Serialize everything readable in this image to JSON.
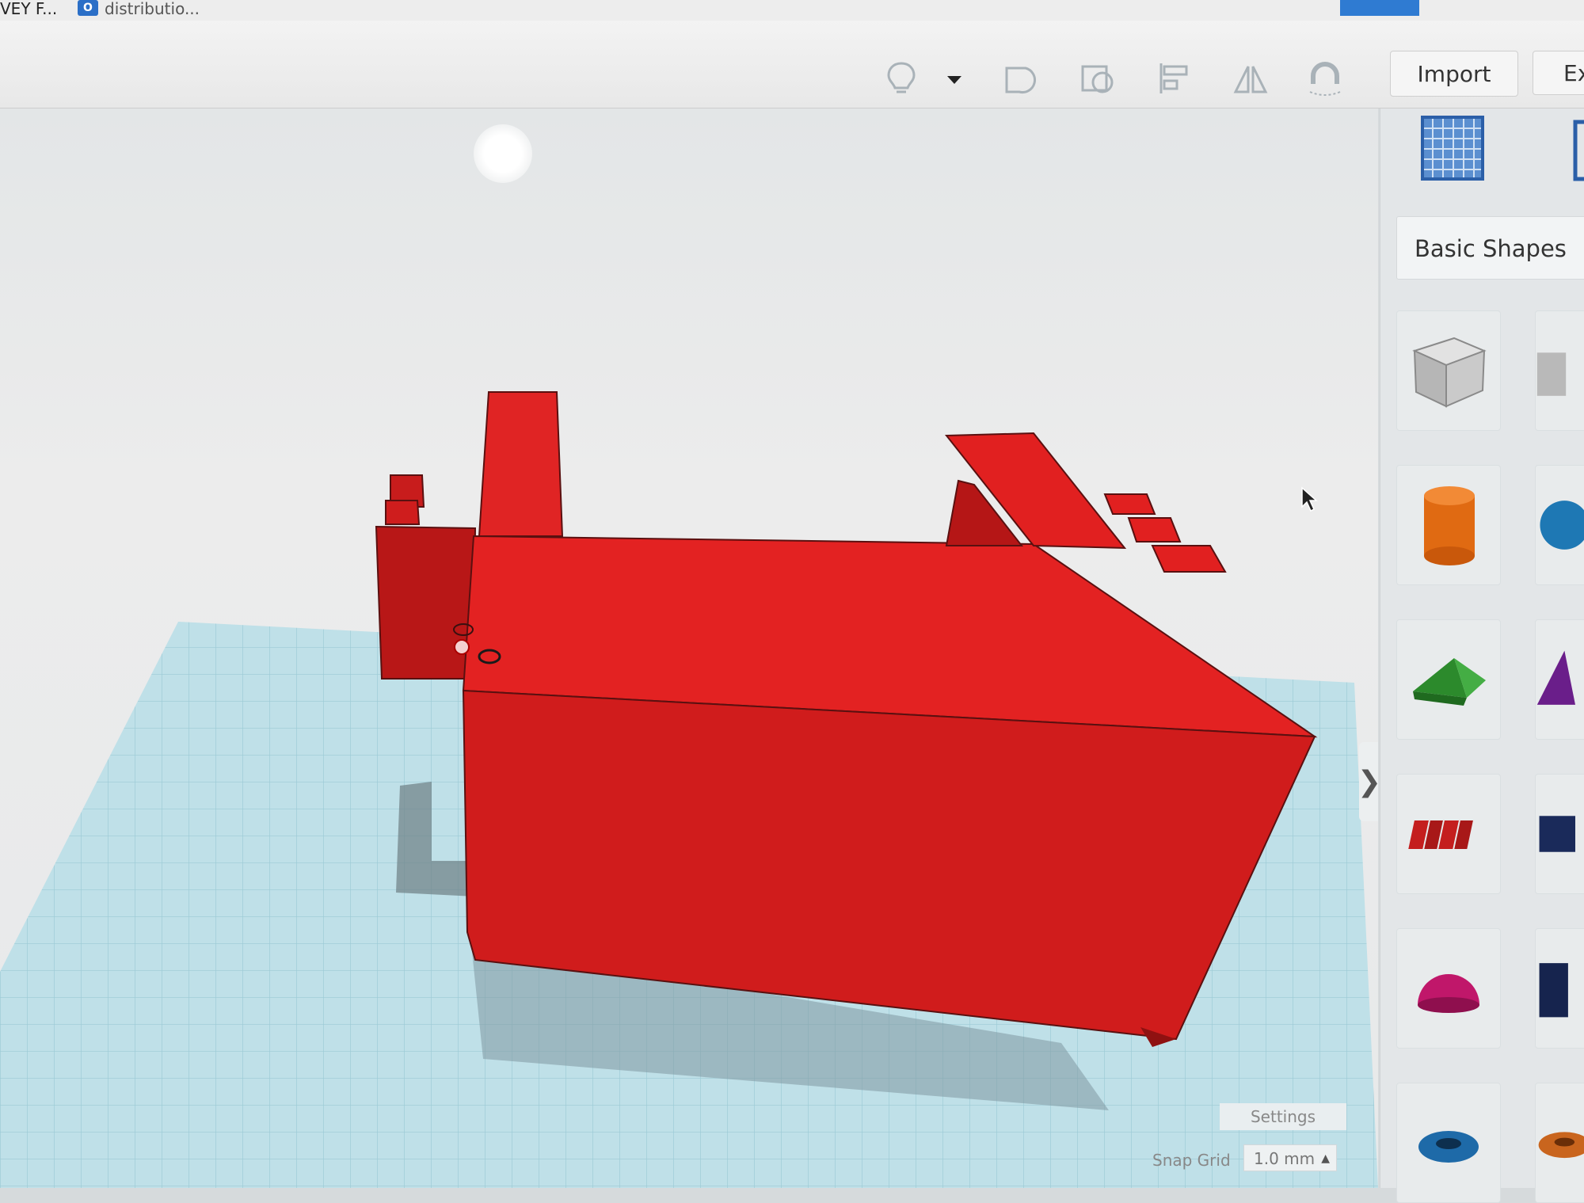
{
  "tabs": {
    "left_tab_label": "VEY F...",
    "right_tab_label": "distributio..."
  },
  "toolbar": {
    "tools": [
      {
        "name": "lightbulb-icon"
      },
      {
        "name": "dropdown-caret-icon"
      },
      {
        "name": "workplane-icon"
      },
      {
        "name": "ruler-icon"
      },
      {
        "name": "align-icon"
      },
      {
        "name": "mirror-icon"
      },
      {
        "name": "magnet-icon"
      }
    ],
    "import_label": "Import",
    "export_label": "Ex"
  },
  "viewport": {
    "model_color": "#d81e1e",
    "grid_color": "#b8dbe4",
    "settings_label": "Settings",
    "snap_grid_label": "Snap Grid",
    "snap_grid_value": "1.0 mm",
    "snap_caret": "▲",
    "collapse_chevron": "❯"
  },
  "panel": {
    "category": "Basic Shapes",
    "shapes": [
      {
        "name": "box-shape",
        "color": "#c8c8c8"
      },
      {
        "name": "cylinder-shape",
        "color": "#e06a12"
      },
      {
        "name": "roof-shape",
        "color": "#2f9a2f"
      },
      {
        "name": "text-shape",
        "color": "#c41e1e"
      },
      {
        "name": "half-sphere-shape",
        "color": "#c0176a"
      },
      {
        "name": "torus-shape",
        "color": "#1e6aa8"
      }
    ]
  }
}
